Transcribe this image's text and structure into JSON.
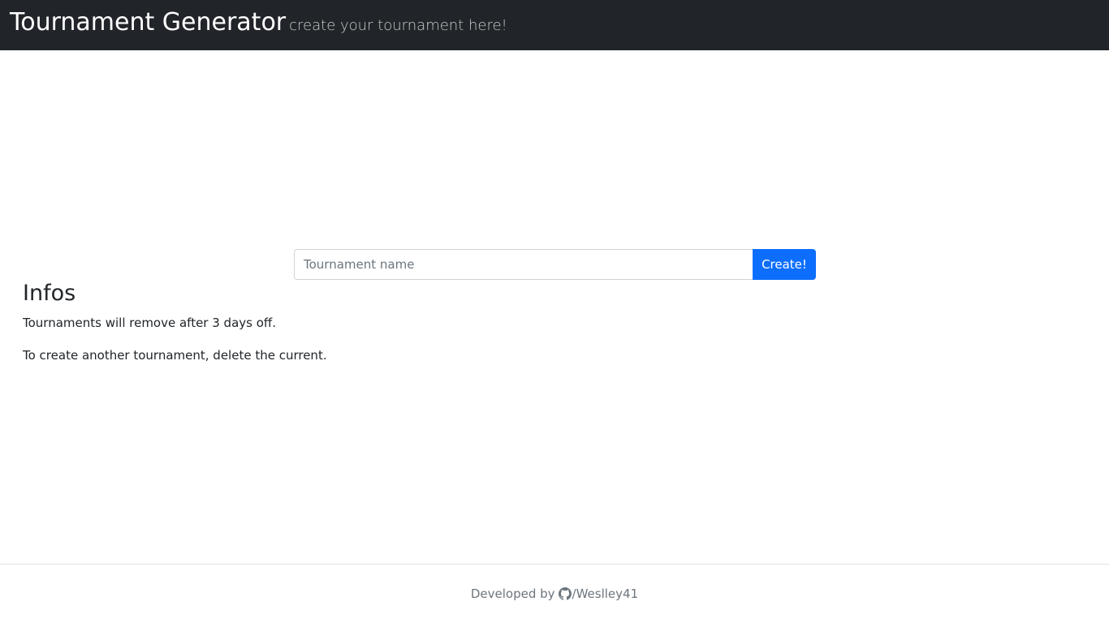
{
  "header": {
    "title": "Tournament Generator",
    "tagline": "create your tournament here!"
  },
  "form": {
    "input_placeholder": "Tournament name",
    "input_value": "",
    "button_label": "Create!"
  },
  "infos": {
    "heading": "Infos",
    "lines": [
      "Tournaments will remove after 3 days off.",
      "To create another tournament, delete the current."
    ]
  },
  "footer": {
    "developed_by": "Developed by",
    "github_icon": "github-icon",
    "user": "/Weslley41"
  },
  "colors": {
    "navbar_bg": "#212529",
    "primary": "#0d6efd",
    "muted_text": "#6c757d"
  }
}
